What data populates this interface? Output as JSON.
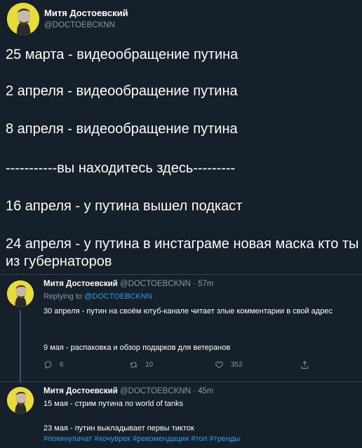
{
  "main_tweet": {
    "author_name": "Митя Достоевский",
    "handle": "@DOCTOEBCKNN",
    "lines": [
      "25 марта - видеообращение путина",
      "2 апреля - видеообращение путина",
      "8 апреля - видеообращение путина",
      "-----------вы находитесь здесь---------",
      "16 апреля - у путина вышел подкаст",
      "24 апреля - у путина в инстаграме новая маска кто ты из губернаторов"
    ]
  },
  "reply_1": {
    "author_name": "Митя Достоевский",
    "handle": "@DOCTOEBCKNN",
    "separator": "·",
    "time": "57m",
    "replying_prefix": "Replying to",
    "replying_handle": "@DOCTOEBCKNN",
    "text_1": "30 апреля - путин на своём ютуб-канале читает злые комментарии в свой адрес",
    "text_2": "9 мая - распаковка и обзор подарков для ветеранов",
    "actions": {
      "reply_count": "6",
      "retweet_count": "10",
      "like_count": "352"
    }
  },
  "reply_2": {
    "author_name": "Митя Достоевский",
    "handle": "@DOCTOEBCKNN",
    "separator": "·",
    "time": "45m",
    "text_1": "15 мая - стрим путина по world of tanks",
    "text_2": "23 мая - путин выкладывает первы тикток",
    "hashtags": "#покинулачат #хочуврек #рекомендации #топ #тренды"
  },
  "icons": {
    "reply": "reply-icon",
    "retweet": "retweet-icon",
    "like": "like-icon",
    "share": "share-icon"
  },
  "colors": {
    "background": "#15202b",
    "text": "#ffffff",
    "muted": "#8899a6",
    "link": "#1da1f2",
    "divider": "#38444d",
    "avatar_bg": "#e8dc3a"
  }
}
